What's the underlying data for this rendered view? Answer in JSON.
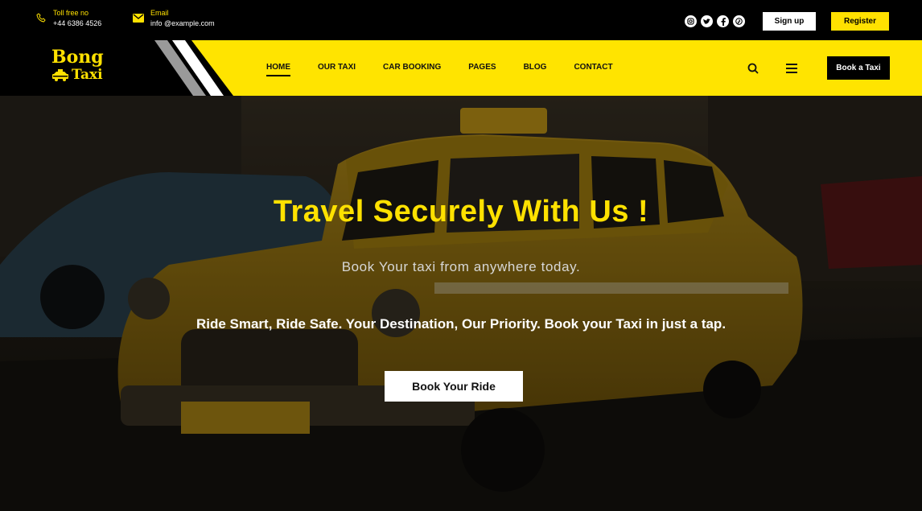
{
  "topbar": {
    "phone": {
      "label": "Toll free no",
      "value": "+44 6386 4526",
      "icon": "phone-icon"
    },
    "email": {
      "label": "Email",
      "value": "info @example.com",
      "icon": "mail-icon"
    },
    "socials": [
      "instagram-icon",
      "twitter-icon",
      "facebook-icon",
      "pinterest-icon"
    ],
    "signup_label": "Sign up",
    "register_label": "Register"
  },
  "brand": {
    "line1": "Bong",
    "line2": "Taxi"
  },
  "nav": {
    "items": [
      "HOME",
      "OUR TAXI",
      "CAR BOOKING",
      "PAGES",
      "BLOG",
      "CONTACT"
    ],
    "active": "HOME",
    "book_label": "Book a Taxi"
  },
  "hero": {
    "title": "Travel Securely With Us !",
    "subtitle": "Book Your taxi from anywhere today.",
    "tagline": "Ride Smart, Ride Safe. Your Destination, Our Priority. Book your Taxi in just a tap.",
    "cta_label": "Book Your Ride"
  },
  "colors": {
    "accent": "#ffe400",
    "dark": "#000000",
    "light": "#ffffff"
  }
}
